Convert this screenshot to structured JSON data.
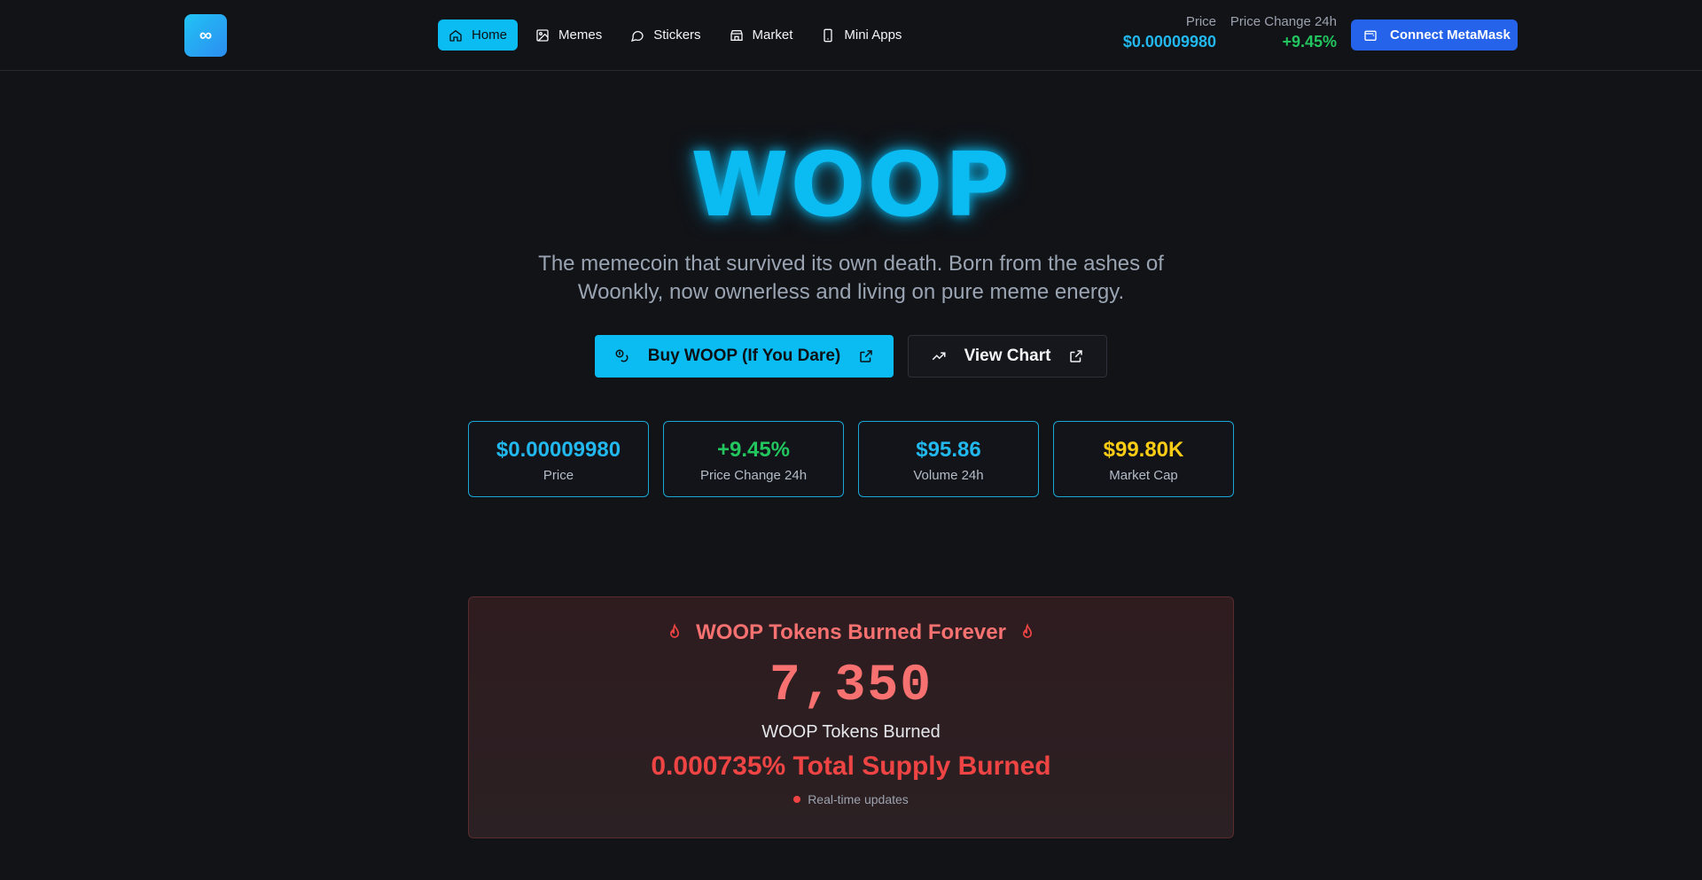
{
  "logo": {
    "glyph": "∞"
  },
  "nav": {
    "items": [
      {
        "label": "Home",
        "icon": "home-icon",
        "active": true
      },
      {
        "label": "Memes",
        "icon": "image-icon"
      },
      {
        "label": "Stickers",
        "icon": "chat-bubble-icon"
      },
      {
        "label": "Market",
        "icon": "store-icon"
      },
      {
        "label": "Mini Apps",
        "icon": "phone-icon"
      }
    ]
  },
  "header": {
    "price_label": "Price",
    "price_value": "$0.00009980",
    "change_label": "Price Change 24h",
    "change_value": "+9.45%",
    "connect_label": "Connect MetaMask"
  },
  "hero": {
    "title": "WOOP",
    "subtitle": "The memecoin that survived its own death. Born from the ashes of Woonkly, now ownerless and living on pure meme energy.",
    "buy_label": "Buy WOOP (If You Dare)",
    "chart_label": "View Chart"
  },
  "stats": [
    {
      "value": "$0.00009980",
      "label": "Price",
      "color": "#22b8ee"
    },
    {
      "value": "+9.45%",
      "label": "Price Change 24h",
      "color": "#22c55e"
    },
    {
      "value": "$95.86",
      "label": "Volume 24h",
      "color": "#22b8ee"
    },
    {
      "value": "$99.80K",
      "label": "Market Cap",
      "color": "#facc15"
    }
  ],
  "burn": {
    "title": "WOOP Tokens Burned Forever",
    "count": "7,350",
    "label": "WOOP Tokens Burned",
    "percent": "0.000735% Total Supply Burned",
    "live": "Real-time updates"
  },
  "colors": {
    "accent": "#0bbcf3",
    "connect": "#2563eb",
    "positive": "#22c55e",
    "burn": "#f87171"
  }
}
